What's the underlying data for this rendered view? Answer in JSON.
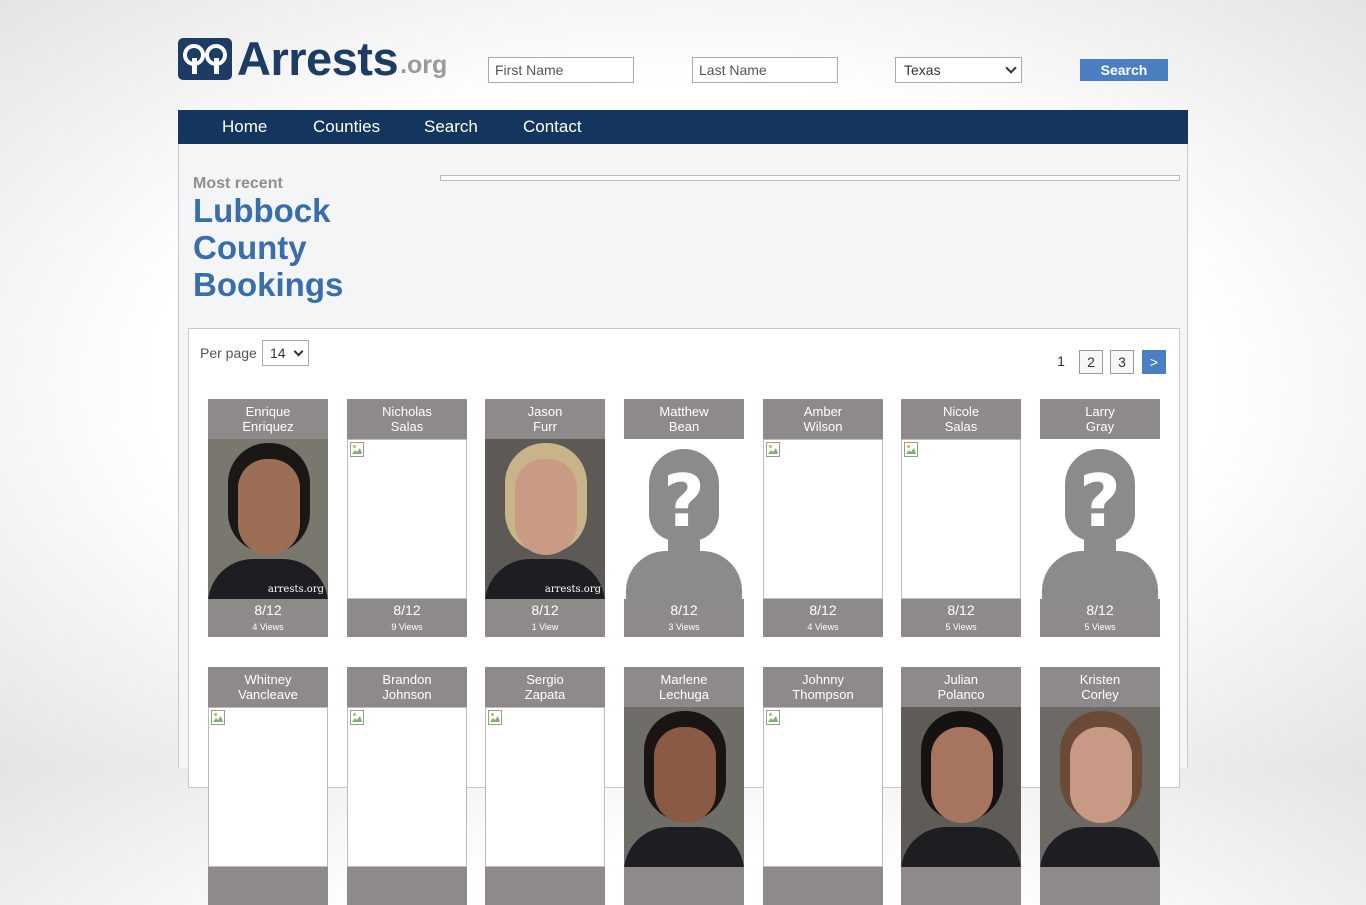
{
  "header": {
    "logo_text": "Arrests",
    "logo_suffix": ".org",
    "first_name_placeholder": "First Name",
    "last_name_placeholder": "Last Name",
    "state_selected": "Texas",
    "search_label": "Search"
  },
  "nav": {
    "items": [
      {
        "label": "Home"
      },
      {
        "label": "Counties"
      },
      {
        "label": "Search"
      },
      {
        "label": "Contact"
      }
    ]
  },
  "main": {
    "kicker": "Most recent",
    "title_lines": [
      "Lubbock",
      "County",
      "Bookings"
    ]
  },
  "listing": {
    "per_page_label": "Per page",
    "per_page_value": "14",
    "pages": [
      "1",
      "2",
      "3"
    ],
    "next_label": ">"
  },
  "bookings": [
    {
      "first": "Enrique",
      "last": "Enriquez",
      "date": "8/12",
      "views": "4 Views",
      "photo": "mugshot"
    },
    {
      "first": "Nicholas",
      "last": "Salas",
      "date": "8/12",
      "views": "9 Views",
      "photo": "broken"
    },
    {
      "first": "Jason",
      "last": "Furr",
      "date": "8/12",
      "views": "1 View",
      "photo": "mugshot"
    },
    {
      "first": "Matthew",
      "last": "Bean",
      "date": "8/12",
      "views": "3 Views",
      "photo": "placeholder"
    },
    {
      "first": "Amber",
      "last": "Wilson",
      "date": "8/12",
      "views": "4 Views",
      "photo": "broken"
    },
    {
      "first": "Nicole",
      "last": "Salas",
      "date": "8/12",
      "views": "5 Views",
      "photo": "broken"
    },
    {
      "first": "Larry",
      "last": "Gray",
      "date": "8/12",
      "views": "5 Views",
      "photo": "placeholder"
    },
    {
      "first": "Whitney",
      "last": "Vancleave",
      "photo": "broken"
    },
    {
      "first": "Brandon",
      "last": "Johnson",
      "photo": "broken"
    },
    {
      "first": "Sergio",
      "last": "Zapata",
      "photo": "broken"
    },
    {
      "first": "Marlene",
      "last": "Lechuga",
      "photo": "mugshot"
    },
    {
      "first": "Johnny",
      "last": "Thompson",
      "photo": "broken"
    },
    {
      "first": "Julian",
      "last": "Polanco",
      "photo": "mugshot"
    },
    {
      "first": "Kristen",
      "last": "Corley",
      "photo": "mugshot"
    }
  ],
  "watermark": "arrests.org",
  "colors": {
    "brand": "#1c3c63",
    "nav": "#14365e",
    "accent": "#4a7fc1",
    "title": "#3a6eaa",
    "card": "#8f8a8a"
  }
}
